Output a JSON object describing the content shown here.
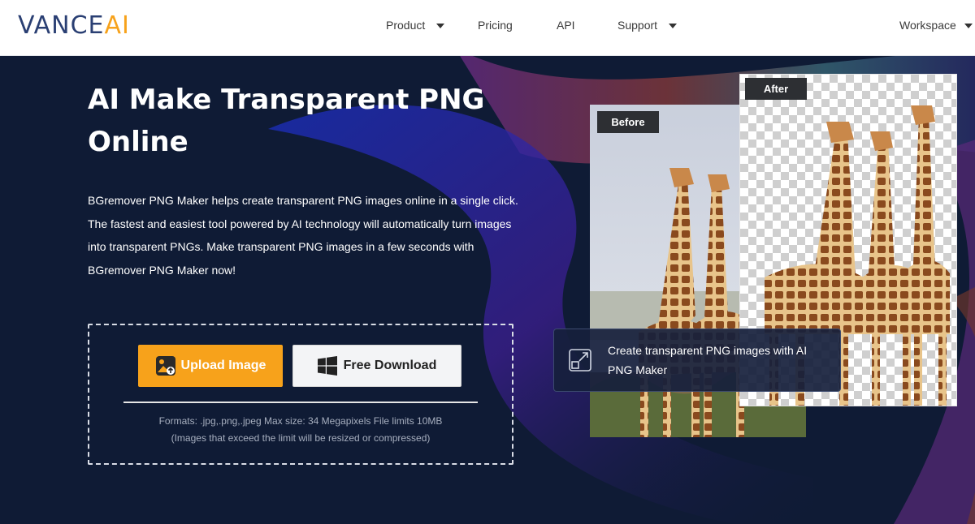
{
  "header": {
    "logo_left": "VANCE",
    "logo_right": "AI",
    "nav": [
      {
        "label": "Product",
        "dropdown": true
      },
      {
        "label": "Pricing",
        "dropdown": false
      },
      {
        "label": "API",
        "dropdown": false
      },
      {
        "label": "Support",
        "dropdown": true
      },
      {
        "label": "Workspace",
        "dropdown": true
      }
    ]
  },
  "hero": {
    "title_line1": "AI Make Transparent PNG",
    "title_line2": "Online",
    "description": "BGremover PNG Maker helps create transparent PNG images online in a single click. The fastest and easiest tool powered by AI technology will automatically turn images into transparent PNGs. Make transparent PNG images in a few seconds with BGremover PNG Maker now!",
    "upload_button": "Upload Image",
    "download_button": "Free Download",
    "formats_line1": "Formats: .jpg,.png,.jpeg Max size: 34 Megapixels File limits 10MB",
    "formats_line2": "(Images that exceed the limit will be resized or compressed)"
  },
  "preview": {
    "before_label": "Before",
    "after_label": "After",
    "caption": "Create transparent PNG images with AI PNG Maker"
  },
  "colors": {
    "brand_orange": "#f7a21b",
    "brand_navy": "#2a3f73",
    "hero_bg": "#0f1b35"
  },
  "icons": [
    "chevron-down-icon",
    "image-upload-icon",
    "windows-logo-icon",
    "expand-icon"
  ]
}
